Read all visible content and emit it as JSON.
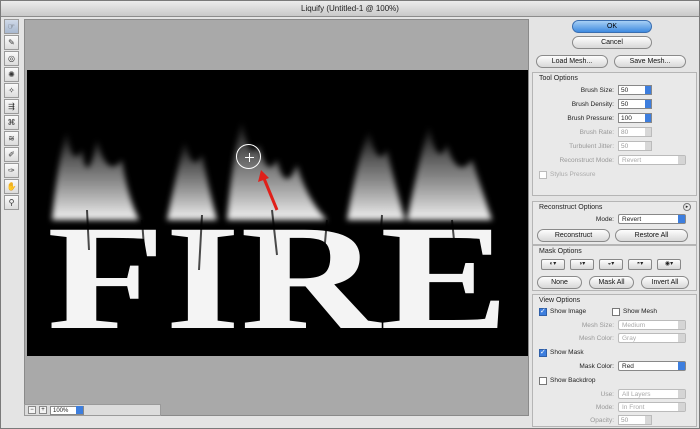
{
  "window": {
    "title": "Liquify (Untitled-1 @ 100%)"
  },
  "tools": [
    {
      "name": "forward-warp-tool-icon",
      "glyph": "☞"
    },
    {
      "name": "reconstruct-tool-icon",
      "glyph": "✎"
    },
    {
      "name": "twirl-clockwise-tool-icon",
      "glyph": "◎"
    },
    {
      "name": "pucker-tool-icon",
      "glyph": "✺"
    },
    {
      "name": "bloat-tool-icon",
      "glyph": "✧"
    },
    {
      "name": "push-left-tool-icon",
      "glyph": "⇶"
    },
    {
      "name": "mirror-tool-icon",
      "glyph": "⌘"
    },
    {
      "name": "turbulence-tool-icon",
      "glyph": "≋"
    },
    {
      "name": "freeze-mask-tool-icon",
      "glyph": "✐"
    },
    {
      "name": "thaw-mask-tool-icon",
      "glyph": "✑"
    },
    {
      "name": "hand-tool-icon",
      "glyph": "✋"
    },
    {
      "name": "zoom-tool-icon",
      "glyph": "⚲"
    }
  ],
  "canvas": {
    "text": "FIRE",
    "zoom": "100%"
  },
  "buttons": {
    "ok": "OK",
    "cancel": "Cancel",
    "load_mesh": "Load Mesh...",
    "save_mesh": "Save Mesh..."
  },
  "tool_options": {
    "title": "Tool Options",
    "brush_size": {
      "label": "Brush Size:",
      "value": "50"
    },
    "brush_density": {
      "label": "Brush Density:",
      "value": "50"
    },
    "brush_pressure": {
      "label": "Brush Pressure:",
      "value": "100"
    },
    "brush_rate": {
      "label": "Brush Rate:",
      "value": "80"
    },
    "turbulent_jitter": {
      "label": "Turbulent Jitter:",
      "value": "50"
    },
    "reconstruct_mode": {
      "label": "Reconstruct Mode:",
      "value": "Revert"
    },
    "stylus_pressure": "Stylus Pressure"
  },
  "reconstruct_options": {
    "title": "Reconstruct Options",
    "mode_label": "Mode:",
    "mode_value": "Revert",
    "reconstruct": "Reconstruct",
    "restore_all": "Restore All"
  },
  "mask_options": {
    "title": "Mask Options",
    "none": "None",
    "mask_all": "Mask All",
    "invert_all": "Invert All"
  },
  "view_options": {
    "title": "View Options",
    "show_image": "Show Image",
    "show_mesh": "Show Mesh",
    "mesh_size_label": "Mesh Size:",
    "mesh_size_value": "Medium",
    "mesh_color_label": "Mesh Color:",
    "mesh_color_value": "Gray",
    "show_mask": "Show Mask",
    "mask_color_label": "Mask Color:",
    "mask_color_value": "Red",
    "show_backdrop": "Show Backdrop",
    "use_label": "Use:",
    "use_value": "All Layers",
    "mode_label": "Mode:",
    "mode_value": "In Front",
    "opacity_label": "Opacity:",
    "opacity_value": "50"
  },
  "colors": {
    "accent": "#3d7ede",
    "arrow": "#e0201a"
  }
}
